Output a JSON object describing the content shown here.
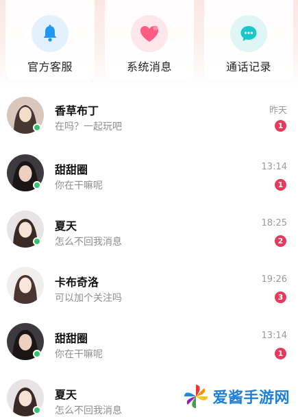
{
  "shortcuts": [
    {
      "label": "官方客服",
      "icon": "bell-icon",
      "color": "#2196f3"
    },
    {
      "label": "系统消息",
      "icon": "heart-icon",
      "color": "#ff4d79"
    },
    {
      "label": "通话记录",
      "icon": "chat-bubble-icon",
      "color": "#18c7c9"
    }
  ],
  "conversations": [
    {
      "name": "香草布丁",
      "message": "在吗？一起玩吧",
      "time": "昨天",
      "unread": "1",
      "online": true
    },
    {
      "name": "甜甜圈",
      "message": "你在干嘛呢",
      "time": "13:14",
      "unread": "1",
      "online": true
    },
    {
      "name": "夏天",
      "message": "怎么不回我消息",
      "time": "18:25",
      "unread": "2",
      "online": true
    },
    {
      "name": "卡布奇洛",
      "message": "可以加个关注吗",
      "time": "19:26",
      "unread": "3",
      "online": false
    },
    {
      "name": "甜甜圈",
      "message": "你在干嘛呢",
      "time": "13:14",
      "unread": "1",
      "online": true
    },
    {
      "name": "夏天",
      "message": "怎么不回我消息",
      "time": "",
      "unread": "",
      "online": true
    }
  ],
  "watermark": {
    "text": "爱酱手游网"
  },
  "colors": {
    "badge": "#e8395a",
    "online": "#35c46d",
    "accent_blue": "#1d7fd8"
  }
}
